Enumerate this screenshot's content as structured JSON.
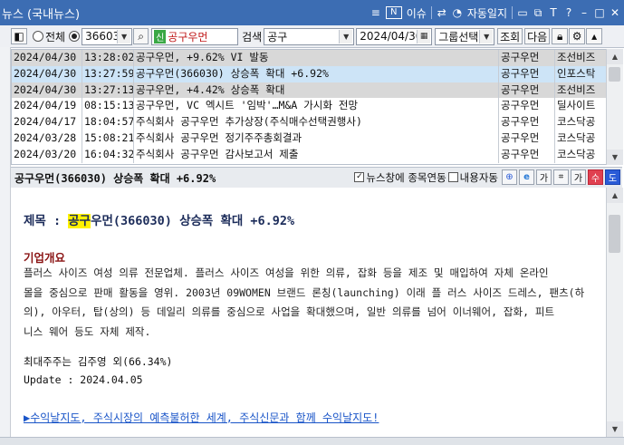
{
  "window": {
    "title": "뉴스 (국내뉴스)",
    "icons": [
      "pin-icon",
      "n-badge-icon",
      "link-icon",
      "clock-icon",
      "window-icon",
      "copy-icon",
      "font-icon",
      "help-icon",
      "minimize-icon",
      "maximize-icon",
      "close-icon"
    ],
    "n_label": "N",
    "issue_label": "이슈",
    "auto_label": "자동일지",
    "font_label": "T",
    "help_label": "?"
  },
  "toolbar": {
    "all_label": "전체",
    "code_value": "366030",
    "stock_badge": "신",
    "stock_name": "공구우먼",
    "search_label": "검색",
    "search_value": "공구",
    "date_value": "2024/04/30",
    "group_select": "그룹선택",
    "query_button": "조회",
    "next_button": "다음"
  },
  "news_list": {
    "rows": [
      {
        "date": "2024/04/30",
        "time": "13:28:02",
        "title": "공구우먼, +9.62% VI 발동",
        "stock": "공구우먼",
        "source": "조선비즈"
      },
      {
        "date": "2024/04/30",
        "time": "13:27:59",
        "title": "공구우먼(366030) 상승폭 확대 +6.92%",
        "stock": "공구우먼",
        "source": "인포스탁"
      },
      {
        "date": "2024/04/30",
        "time": "13:27:13",
        "title": "공구우먼, +4.42% 상승폭 확대",
        "stock": "공구우먼",
        "source": "조선비즈"
      },
      {
        "date": "2024/04/19",
        "time": "08:15:13",
        "title": "공구우먼, VC 엑시트 '임박'…M&A 가시화 전망",
        "stock": "공구우먼",
        "source": "딜사이트"
      },
      {
        "date": "2024/04/17",
        "time": "18:04:57",
        "title": "주식회사 공구우먼 추가상장(주식매수선택권행사)",
        "stock": "공구우먼",
        "source": "코스닥공"
      },
      {
        "date": "2024/03/28",
        "time": "15:08:21",
        "title": "주식회사 공구우먼 정기주주총회결과",
        "stock": "공구우먼",
        "source": "코스닥공"
      },
      {
        "date": "2024/03/20",
        "time": "16:04:32",
        "title": "주식회사 공구우먼 감사보고서 제출",
        "stock": "공구우먼",
        "source": "코스닥공"
      }
    ]
  },
  "detail_header": {
    "title": "공구우먼(366030) 상승폭 확대 +6.92%",
    "sync_label": "뉴스창에 종목연동",
    "auto_label": "내용자동",
    "plus_label": "수",
    "minus_label": "도"
  },
  "article": {
    "headline_prefix": "제목 : ",
    "headline_hl": "공구",
    "headline_rest": "우먼(366030) 상승폭 확대 +6.92%",
    "section_title": "기업개요",
    "paragraph_lines": [
      "플러스 사이즈 여성 의류 전문업체. 플러스 사이즈 여성을 위한 의류, 잡화 등을 제조 및 매입하여 자체 온라인",
      "몰을 중심으로 판매 활동을 영위. 2003년 09WOMEN 브랜드 론칭(launching) 이래 플 러스 사이즈 드레스, 팬츠(하",
      "의), 아우터, 탑(상의) 등 데일리 의류를 중심으로 사업을 확대했으며, 일반 의류를 넘어 이너웨어, 잡화, 피트",
      "니스 웨어 등도 자체 제작."
    ],
    "shareholder": "최대주주는 김주영 외(66.34%)",
    "update": "Update : 2024.04.05",
    "ad_link": "▶수익날지도, 주식시장의 예측불허한 세계, 주식신문과 함께 수익날지도!"
  },
  "colors": {
    "titlebar": "#3c6db3",
    "row_selected_blue": "#cde4f7",
    "row_selected_gray": "#d8d8d8",
    "section_red": "#8b1515",
    "link_blue": "#1a55c8",
    "plus_red": "#e04050",
    "minus_blue": "#2a5bd7"
  }
}
